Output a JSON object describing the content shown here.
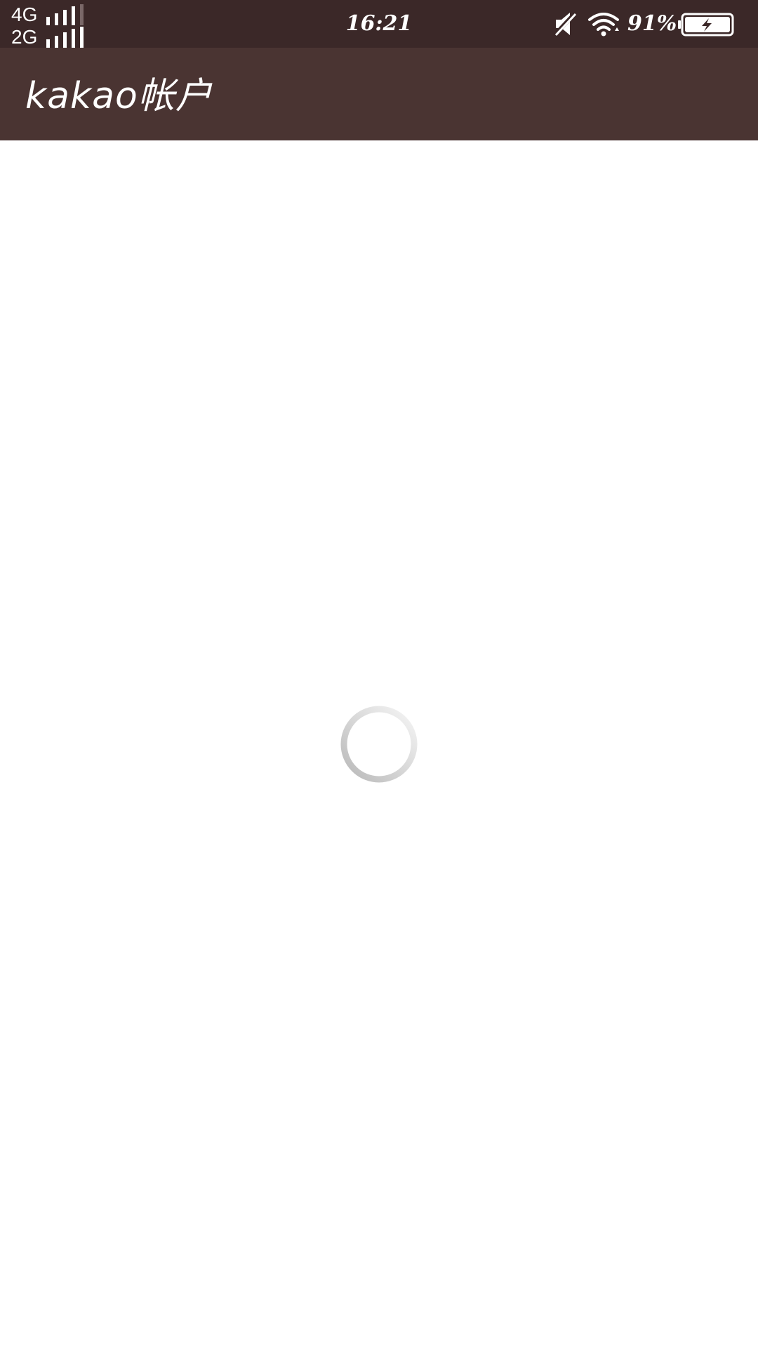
{
  "status_bar": {
    "network_1": "4G",
    "network_2": "2G",
    "time": "16:21",
    "battery_percent": "91%",
    "icons": [
      "mute-icon",
      "wifi-icon",
      "battery-charging-icon",
      "signal-icon"
    ]
  },
  "app_bar": {
    "title": "kakao帐户"
  },
  "content": {
    "loading_indicator": "loading-spinner-icon"
  },
  "colors": {
    "status_bar_bg": "#3b2828",
    "app_bar_bg": "#4a3432",
    "content_bg": "#ffffff",
    "spinner": "#bdbdbd"
  }
}
